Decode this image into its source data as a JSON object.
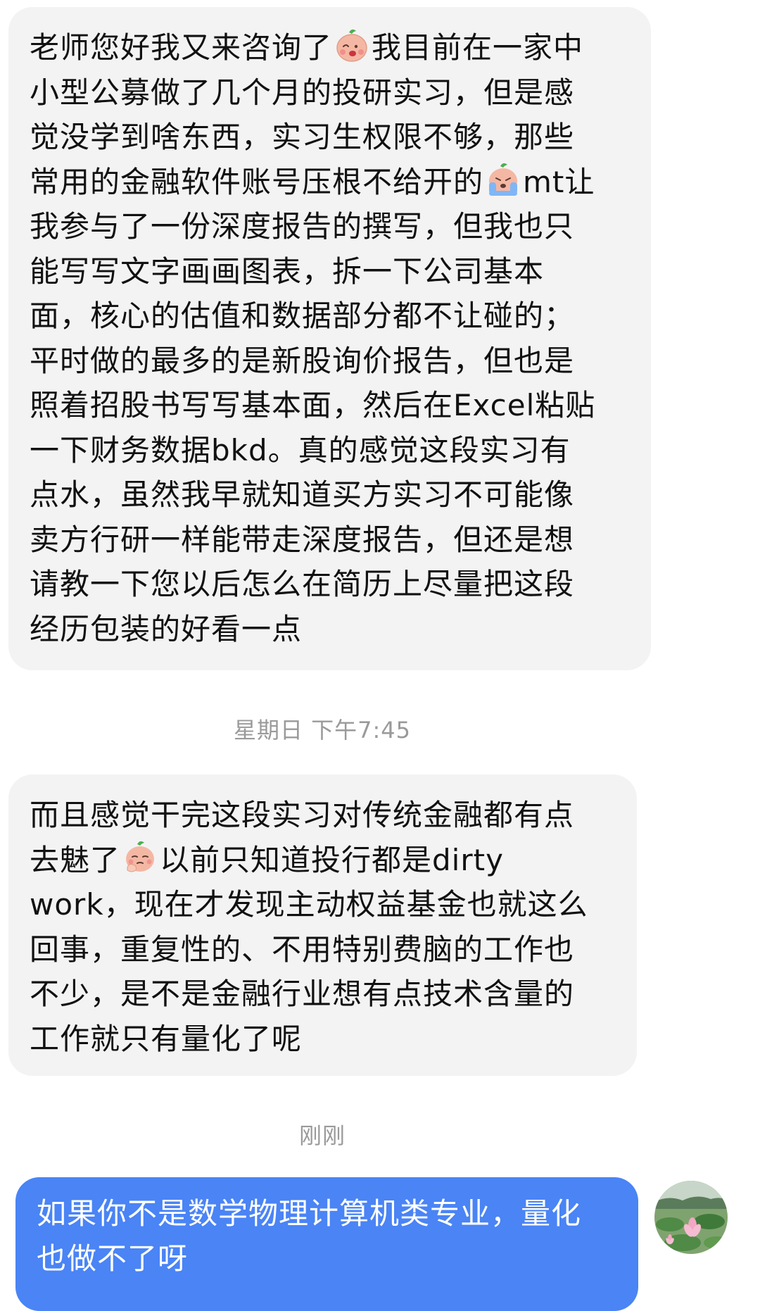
{
  "messages": [
    {
      "lines": [
        {
          "parts": [
            "老师您好我又来咨询了",
            "我目前在一家中"
          ],
          "emoji": "shy-face-emoji"
        },
        {
          "text": "小型公募做了几个月的投研实习，但是感"
        },
        {
          "text": "觉没学到啥东西，实习生权限不够，那些"
        },
        {
          "parts": [
            "常用的金融软件账号压根不给开的",
            "mt让"
          ],
          "emoji": "crying-face-emoji"
        },
        {
          "text": "我参与了一份深度报告的撰写，但我也只"
        },
        {
          "text": "能写写文字画画图表，拆一下公司基本"
        },
        {
          "text": "面，核心的估值和数据部分都不让碰的；"
        },
        {
          "text": "平时做的最多的是新股询价报告，但也是"
        },
        {
          "text": "照着招股书写写基本面，然后在Excel粘贴"
        },
        {
          "text": "一下财务数据bkd。真的感觉这段实习有"
        },
        {
          "text": "点水，虽然我早就知道买方实习不可能像"
        },
        {
          "text": "卖方行研一样能带走深度报告，但还是想"
        },
        {
          "text": "请教一下您以后怎么在简历上尽量把这段"
        },
        {
          "text": "经历包装的好看一点"
        }
      ]
    },
    {
      "lines": [
        {
          "text": "而且感觉干完这段实习对传统金融都有点"
        },
        {
          "parts": [
            "去魅了",
            "以前只知道投行都是dirty"
          ],
          "emoji": "thinking-face-emoji"
        },
        {
          "text": "work，现在才发现主动权益基金也就这么"
        },
        {
          "text": "回事，重复性的、不用特别费脑的工作也"
        },
        {
          "text": "不少，是不是金融行业想有点技术含量的"
        },
        {
          "text": "工作就只有量化了呢"
        }
      ]
    }
  ],
  "timestamps": [
    "星期日 下午7:45",
    "刚刚"
  ],
  "reply": {
    "lines": [
      "如果你不是数学物理计算机类专业，量化",
      "也做不了呀"
    ]
  },
  "colors": {
    "incoming_bubble": "#f3f3f3",
    "outgoing_bubble": "#4a84f5",
    "timestamp": "#9a9a9a"
  },
  "avatar": {
    "icon": "lotus-avatar"
  }
}
